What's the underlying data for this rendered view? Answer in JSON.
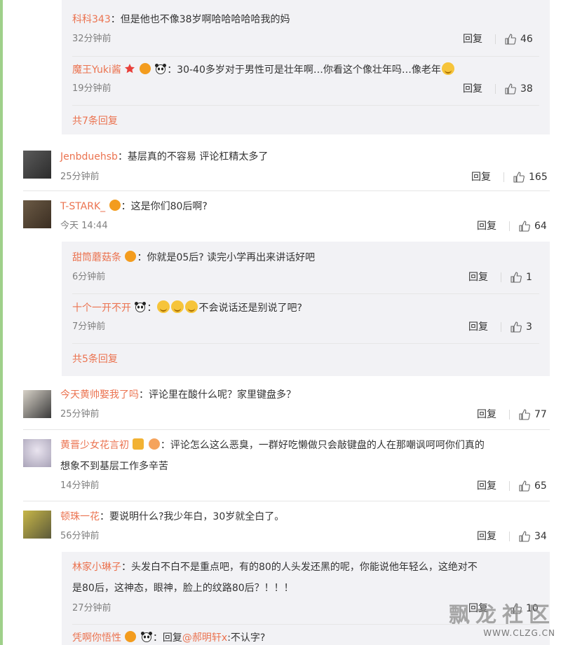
{
  "thread1": {
    "replies": [
      {
        "user": "科科343",
        "text": "：但是他也不像38岁啊哈哈哈哈哈我的妈",
        "time": "32分钟前",
        "reply": "回复",
        "likes": "46"
      },
      {
        "user": "魔王Yuki酱",
        "text": "：30-40多岁对于男性可是壮年啊…你看这个像壮年吗…像老年",
        "time": "19分钟前",
        "reply": "回复",
        "likes": "38"
      }
    ],
    "more": "共7条回复"
  },
  "c1": {
    "user": "Jenbduehsb",
    "text": "：基层真的不容易 评论杠精太多了",
    "time": "25分钟前",
    "reply": "回复",
    "likes": "165"
  },
  "c2": {
    "user": "T-STARK_",
    "text": "：这是你们80后啊?",
    "time": "今天 14:44",
    "reply": "回复",
    "likes": "64"
  },
  "thread2": {
    "replies": [
      {
        "user": "甜筒蘑菇条",
        "text": "：你就是05后? 读完小学再出来讲话好吧",
        "time": "6分钟前",
        "reply": "回复",
        "likes": "1"
      },
      {
        "user": "十个一开不开",
        "text_pre": "：",
        "text": "不会说话还是别说了吧?",
        "time": "7分钟前",
        "reply": "回复",
        "likes": "3"
      }
    ],
    "more": "共5条回复"
  },
  "c3": {
    "user": "今天黄帅娶我了吗",
    "text": "：评论里在酸什么呢？家里键盘多？",
    "time": "25分钟前",
    "reply": "回复",
    "likes": "77"
  },
  "c4": {
    "user": "黄晋少女花言初",
    "text1": "：评论怎么这么恶臭，一群好吃懒做只会敲键盘的人在那嘲讽呵呵你们真的",
    "text2": "想象不到基层工作多辛苦",
    "time": "14分钟前",
    "reply": "回复",
    "likes": "65"
  },
  "c5": {
    "user": "顿珠一花",
    "text": "：要说明什么?我少年白，30岁就全白了。",
    "time": "56分钟前",
    "reply": "回复",
    "likes": "34"
  },
  "thread3": {
    "replies": [
      {
        "user": "林家小琳子",
        "text1": "：头发白不白不是重点吧，有的80的人头发还黑的呢，你能说他年轻么，这绝对不",
        "text2": "是80后，这神态，眼神，脸上的纹路80后？！！！",
        "time": "27分钟前",
        "reply": "回复",
        "likes": "10"
      },
      {
        "user": "凭啊你悟性",
        "text": "：回复",
        "mention": "@郝明轩x",
        "text_post": ":不认字?"
      }
    ]
  },
  "watermark": {
    "title": "飘龙社区",
    "url": "WWW.CLZG.CN"
  },
  "colors": {
    "name": "#eb7350",
    "time": "#808080",
    "reply_bg": "#f2f2f5",
    "gutter": "#9fd08a"
  }
}
